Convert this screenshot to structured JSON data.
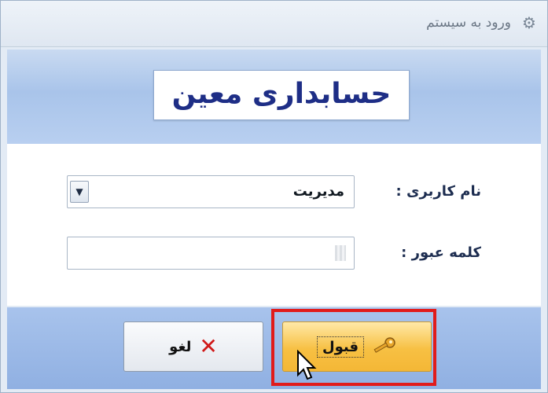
{
  "window": {
    "title": "ورود به سیستم"
  },
  "app": {
    "title": "حسابداری معین"
  },
  "form": {
    "username_label": "نام کاربری :",
    "username_value": "مدیریت",
    "password_label": "کلمه عبور :",
    "password_value": ""
  },
  "buttons": {
    "cancel_label": "لغو",
    "ok_label": "قبول"
  },
  "icons": {
    "window_icon": "window-app-icon",
    "dropdown": "chevron-down-icon",
    "cancel": "close-x-icon",
    "ok": "key-icon",
    "cursor": "mouse-pointer-icon"
  },
  "colors": {
    "app_title": "#1e2e86",
    "highlight": "#e11b1b",
    "ok_button": "#f7c043",
    "cancel_icon": "#d01818"
  }
}
